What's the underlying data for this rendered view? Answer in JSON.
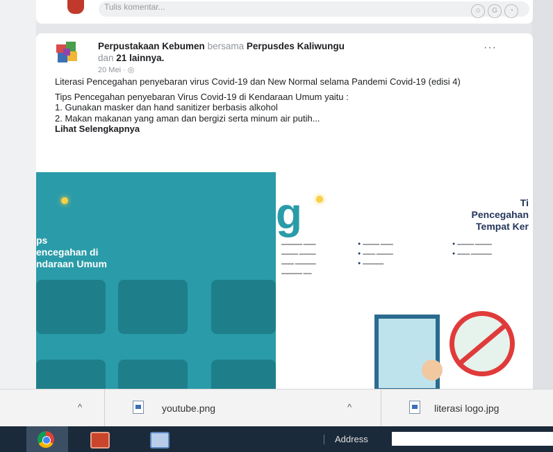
{
  "previous_post": {
    "comment_placeholder": "Tulis komentar...",
    "icons": [
      "emoji-icon",
      "gif-icon",
      "sticker-icon"
    ]
  },
  "post": {
    "author": "Perpustakaan Kebumen",
    "with_word": "bersama",
    "coauthor": "Perpusdes Kaliwungu",
    "and_word": "dan",
    "others": "21 lainnya.",
    "date": "20 Mei · ",
    "privacy_icon": "globe-icon",
    "more_label": "···",
    "title_text": "Literasi Pencegahan penyebaran  virus Covid-19 dan New Normal selama Pandemi Covid-19 (edisi 4)",
    "tips_intro": "Tips Pencegahan penyebaran Virus Covid-19 di Kendaraan Umum yaitu :",
    "tip1": "1. Gunakan masker dan hand sanitizer berbasis alkohol",
    "tip2": "2. Makan makanan yang aman dan bergizi serta minum air putih...",
    "see_more": "Lihat Selengkapnya",
    "image": {
      "left_heading_1": "ps",
      "left_heading_2": "encegahan di",
      "left_heading_3": "ndaraan Umum",
      "big_letters": "g",
      "right_title_1": "Ti",
      "right_title_2": "Pencegahan",
      "right_title_3": "Tempat Ker",
      "accent_teal": "#2a9ba8",
      "accent_yellow": "#f7d046"
    }
  },
  "downloads": {
    "items": [
      {
        "name": "youtube.png",
        "icon": "image-file-icon"
      },
      {
        "name": "literasi logo.jpg",
        "icon": "image-file-icon"
      }
    ],
    "chevron": "^"
  },
  "taskbar": {
    "apps": [
      "chrome-icon",
      "powerpoint-icon",
      "paint-icon"
    ],
    "address_label": "Address"
  }
}
